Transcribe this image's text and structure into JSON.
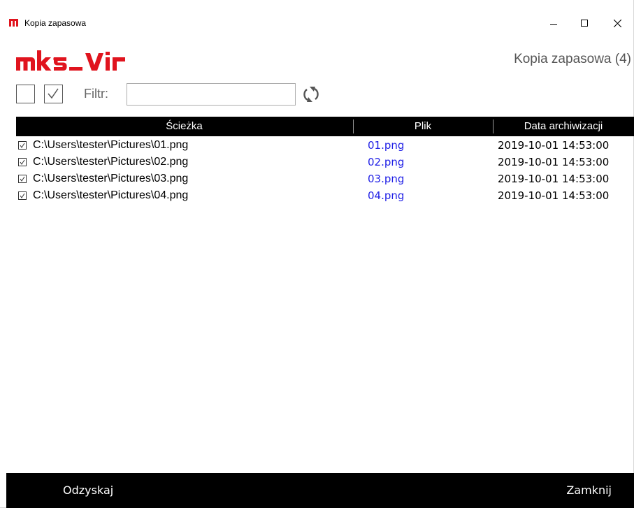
{
  "window": {
    "title": "Kopia zapasowa"
  },
  "header": {
    "logo_text": "mks_vir",
    "title": "Kopia zapasowa (4)"
  },
  "toolbar": {
    "filter_label": "Filtr:",
    "filter_value": ""
  },
  "table": {
    "columns": [
      "Ścieżka",
      "Plik",
      "Data archiwizacji"
    ],
    "rows": [
      {
        "checked": true,
        "path": "C:\\Users\\tester\\Pictures\\01.png",
        "file": "01.png",
        "date": "2019-10-01 14:53:00"
      },
      {
        "checked": true,
        "path": "C:\\Users\\tester\\Pictures\\02.png",
        "file": "02.png",
        "date": "2019-10-01 14:53:00"
      },
      {
        "checked": true,
        "path": "C:\\Users\\tester\\Pictures\\03.png",
        "file": "03.png",
        "date": "2019-10-01 14:53:00"
      },
      {
        "checked": true,
        "path": "C:\\Users\\tester\\Pictures\\04.png",
        "file": "04.png",
        "date": "2019-10-01 14:53:00"
      }
    ]
  },
  "footer": {
    "recover_label": "Odzyskaj",
    "close_label": "Zamknij"
  },
  "colors": {
    "brand": "#e0141e",
    "link": "#1f1fe6",
    "bar": "#000000"
  }
}
